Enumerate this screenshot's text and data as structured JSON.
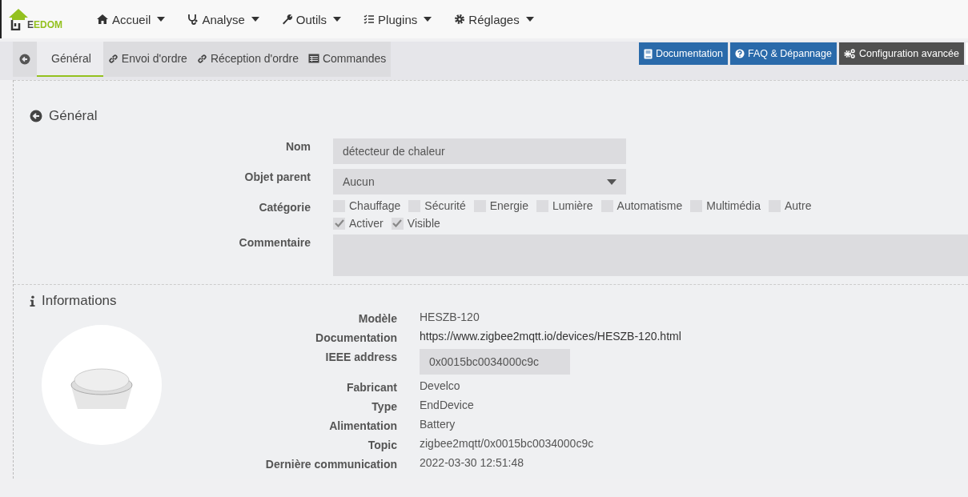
{
  "logo": {
    "text": "EEDOM"
  },
  "menu": [
    {
      "label": "Accueil"
    },
    {
      "label": "Analyse"
    },
    {
      "label": "Outils"
    },
    {
      "label": "Plugins"
    },
    {
      "label": "Réglages"
    }
  ],
  "tabs": [
    {
      "label": "Général",
      "selected": true
    },
    {
      "label": "Envoi d'ordre",
      "selected": false
    },
    {
      "label": "Réception d'ordre",
      "selected": false
    },
    {
      "label": "Commandes",
      "selected": false
    }
  ],
  "actions": [
    {
      "label": "Documentation",
      "kind": "primary"
    },
    {
      "label": "FAQ & Dépannage",
      "kind": "primary"
    },
    {
      "label": "Configuration avancée",
      "kind": "dark"
    }
  ],
  "general": {
    "title": "Général",
    "name_label": "Nom",
    "name_value": "détecteur de chaleur",
    "parent_label": "Objet parent",
    "parent_value": "Aucun",
    "category_label": "Catégorie",
    "categories": [
      {
        "label": "Chauffage",
        "checked": false
      },
      {
        "label": "Sécurité",
        "checked": false
      },
      {
        "label": "Energie",
        "checked": false
      },
      {
        "label": "Lumière",
        "checked": false
      },
      {
        "label": "Automatisme",
        "checked": false
      },
      {
        "label": "Multimédia",
        "checked": false
      },
      {
        "label": "Autre",
        "checked": false
      }
    ],
    "options": [
      {
        "label": "Activer",
        "checked": true
      },
      {
        "label": "Visible",
        "checked": true
      }
    ],
    "comment_label": "Commentaire"
  },
  "informations": {
    "title": "Informations",
    "rows": [
      {
        "label": "Modèle",
        "value": "HESZB-120",
        "kind": "text"
      },
      {
        "label": "Documentation",
        "value": "https://www.zigbee2mqtt.io/devices/HESZB-120.html",
        "kind": "link"
      },
      {
        "label": "IEEE address",
        "value": "0x0015bc0034000c9c",
        "kind": "field"
      },
      {
        "label": "Fabricant",
        "value": "Develco",
        "kind": "text"
      },
      {
        "label": "Type",
        "value": "EndDevice",
        "kind": "text"
      },
      {
        "label": "Alimentation",
        "value": "Battery",
        "kind": "text"
      },
      {
        "label": "Topic",
        "value": "zigbee2mqtt/0x0015bc0034000c9c",
        "kind": "text"
      },
      {
        "label": "Dernière communication",
        "value": "2022-03-30 12:51:48",
        "kind": "text"
      }
    ]
  }
}
